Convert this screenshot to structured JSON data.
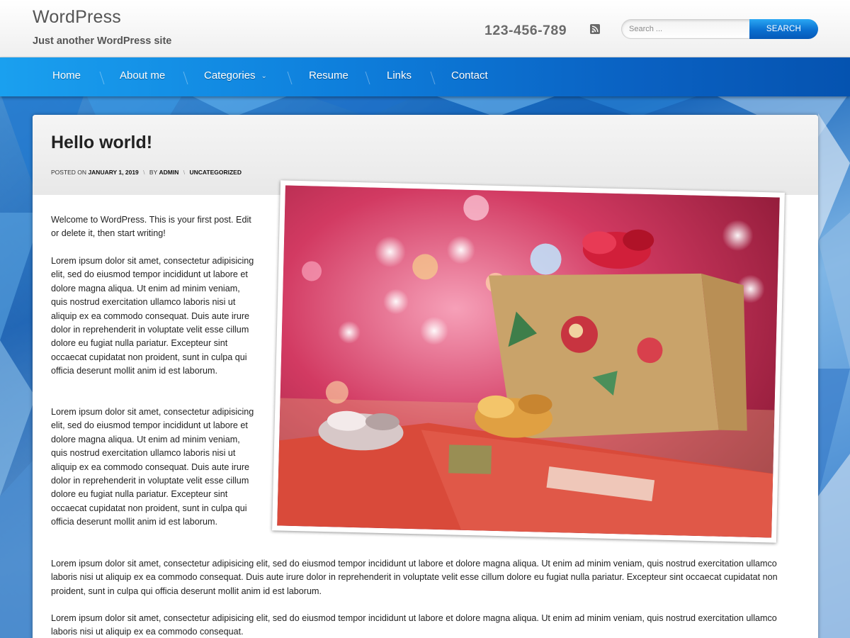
{
  "header": {
    "site_title": "WordPress",
    "tagline": "Just another WordPress site",
    "phone": "123-456-789",
    "rss_icon": "rss-icon",
    "search": {
      "placeholder": "Search ...",
      "button_label": "Search"
    }
  },
  "nav": {
    "items": [
      {
        "label": "Home"
      },
      {
        "label": "About me"
      },
      {
        "label": "Categories",
        "has_dropdown": true,
        "icon": "chevron-down-icon"
      },
      {
        "label": "Resume"
      },
      {
        "label": "Links"
      },
      {
        "label": "Contact"
      }
    ]
  },
  "post": {
    "title": "Hello world!",
    "meta": {
      "posted_on_label": "Posted on",
      "date": "January 1, 2019",
      "by_label": "by",
      "author": "admin",
      "category": "Uncategorized"
    },
    "paragraphs": [
      "Welcome to WordPress. This is your first post. Edit or delete it, then start writing!",
      "Lorem ipsum dolor sit amet, consectetur adipisicing elit, sed do eiusmod tempor incididunt ut labore et dolore magna aliqua. Ut enim ad minim veniam, quis nostrud exercitation ullamco laboris nisi ut aliquip ex ea commodo consequat. Duis aute irure dolor in reprehenderit in voluptate velit esse cillum dolore eu fugiat nulla pariatur. Excepteur sint occaecat cupidatat non proident, sunt in culpa qui officia deserunt mollit anim id est laborum.",
      "Lorem ipsum dolor sit amet, consectetur adipisicing elit, sed do eiusmod tempor incididunt ut labore et dolore magna aliqua. Ut enim ad minim veniam, quis nostrud exercitation ullamco laboris nisi ut aliquip ex ea commodo consequat. Duis aute irure dolor in reprehenderit in voluptate velit esse cillum dolore eu fugiat nulla pariatur. Excepteur sint occaecat cupidatat non proident, sunt in culpa qui officia deserunt mollit anim id est laborum.",
      "Lorem ipsum dolor sit amet, consectetur adipisicing elit, sed do eiusmod tempor incididunt ut labore et dolore magna aliqua. Ut enim ad minim veniam, quis nostrud exercitation ullamco laboris nisi ut aliquip ex ea commodo consequat. Duis aute irure dolor in reprehenderit in voluptate velit esse cillum dolore eu fugiat nulla pariatur. Excepteur sint occaecat cupidatat non proident, sunt in culpa qui officia deserunt mollit anim id est laborum.",
      "Lorem ipsum dolor sit amet, consectetur adipisicing elit, sed do eiusmod tempor incididunt ut labore et dolore magna aliqua. Ut enim ad minim veniam, quis nostrud exercitation ullamco laboris nisi ut aliquip ex ea commodo consequat."
    ]
  },
  "colors": {
    "nav_start": "#1aa0ef",
    "nav_end": "#0553b0",
    "search_button": "#0a6fd0",
    "background": "#1462b8"
  }
}
